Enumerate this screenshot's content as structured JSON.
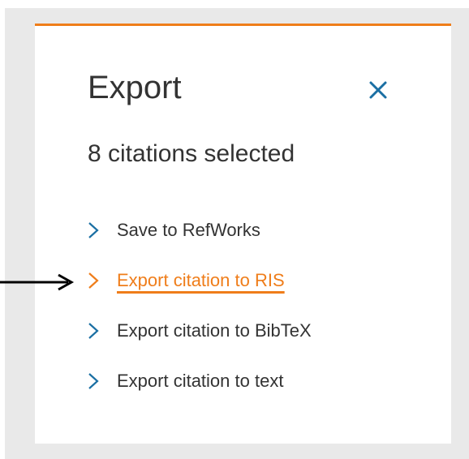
{
  "modal": {
    "title": "Export",
    "subtitle": "8 citations selected",
    "options": [
      {
        "label": "Save to RefWorks",
        "active": false
      },
      {
        "label": "Export citation to RIS",
        "active": true
      },
      {
        "label": "Export citation to BibTeX",
        "active": false
      },
      {
        "label": "Export citation to text",
        "active": false
      }
    ]
  },
  "icons": {
    "close": "close-icon",
    "chevron": "chevron-right-icon",
    "pointer": "arrow-right-icon"
  },
  "colors": {
    "accent": "#ef7d1a",
    "icon_blue": "#1a6fa3",
    "text": "#333333",
    "backdrop": "#e9e9e9"
  }
}
